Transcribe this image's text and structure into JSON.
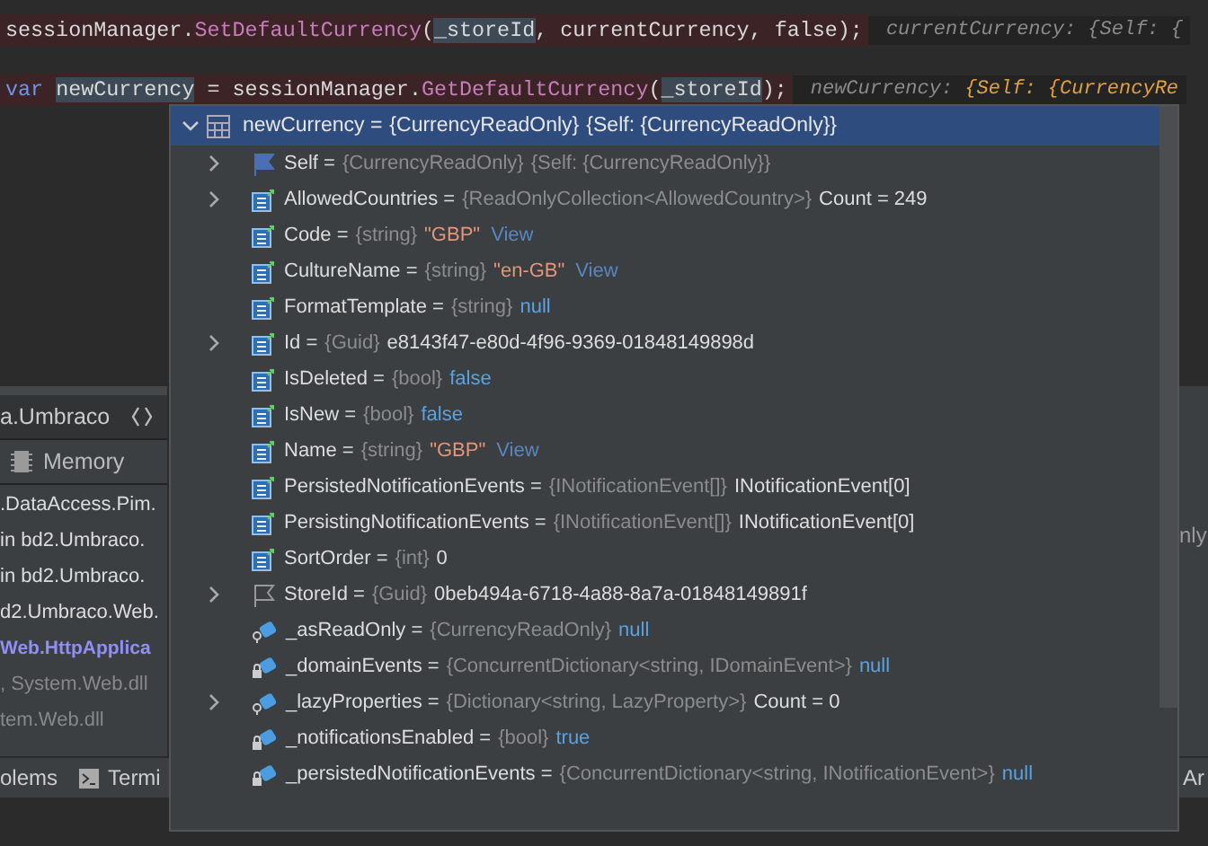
{
  "editor": {
    "lines": [
      {
        "tokens": [
          {
            "text": "sessionManager.",
            "kind": "plain"
          },
          {
            "text": "SetDefaultCurrency",
            "kind": "method"
          },
          {
            "text": "(",
            "kind": "plain"
          },
          {
            "text": "_storeId",
            "kind": "ref"
          },
          {
            "text": ", currentCurrency, false);",
            "kind": "plain"
          }
        ],
        "hints": [
          {
            "text": "currentCurrency: {Self: {",
            "kind": "name"
          }
        ]
      },
      {
        "tokens": [
          {
            "text": "var ",
            "kind": "keyword"
          },
          {
            "text": "newCurrency",
            "kind": "ref"
          },
          {
            "text": " = sessionManager.",
            "kind": "plain"
          },
          {
            "text": "GetDefaultCurrency",
            "kind": "method"
          },
          {
            "text": "(",
            "kind": "plain"
          },
          {
            "text": "_storeId",
            "kind": "ref"
          },
          {
            "text": ");",
            "kind": "plain"
          }
        ],
        "hints": [
          {
            "text": "newCurrency: ",
            "kind": "name"
          },
          {
            "text": "{Self: {CurrencyRe",
            "kind": "value"
          }
        ]
      }
    ]
  },
  "side_panel": {
    "title": "a.Umbraco",
    "tab": "Memory",
    "frames": [
      {
        "text": ".DataAccess.Pim.",
        "kind": "normal"
      },
      {
        "text": "in bd2.Umbraco.",
        "kind": "normal"
      },
      {
        "text": "in bd2.Umbraco.",
        "kind": "normal"
      },
      {
        "text": "d2.Umbraco.Web.",
        "kind": "normal"
      },
      {
        "text": "Web.HttpApplica",
        "kind": "highlight"
      },
      {
        "text": ", System.Web.dll",
        "kind": "library"
      },
      {
        "text": "tem.Web.dll",
        "kind": "library"
      }
    ]
  },
  "right_panel": {
    "texts": [
      "nly"
    ]
  },
  "bottom_bar": {
    "tabs": [
      {
        "label": "olems",
        "icon": false
      },
      {
        "label": "Termi",
        "icon": true
      }
    ],
    "right_text": "Ar"
  },
  "popup": {
    "header": {
      "name": "newCurrency =",
      "type": "{CurrencyReadOnly}",
      "value": "{Self: {CurrencyReadOnly}}",
      "expanded": true
    },
    "rows": [
      {
        "expandable": true,
        "kind": "flag",
        "name": "Self =",
        "type": "{CurrencyReadOnly}",
        "value": {
          "text": "{Self: {CurrencyReadOnly}}",
          "kind": "type"
        }
      },
      {
        "expandable": true,
        "kind": "property",
        "name": "AllowedCountries =",
        "type": "{ReadOnlyCollection<AllowedCountry>}",
        "value": {
          "text": "Count = 249",
          "kind": "plain"
        }
      },
      {
        "expandable": false,
        "kind": "property",
        "name": "Code =",
        "type": "{string}",
        "value": {
          "text": "\"GBP\"",
          "kind": "string"
        },
        "link": "View"
      },
      {
        "expandable": false,
        "kind": "property",
        "name": "CultureName =",
        "type": "{string}",
        "value": {
          "text": "\"en-GB\"",
          "kind": "string"
        },
        "link": "View"
      },
      {
        "expandable": false,
        "kind": "property",
        "name": "FormatTemplate =",
        "type": "{string}",
        "value": {
          "text": "null",
          "kind": "keyword"
        }
      },
      {
        "expandable": true,
        "kind": "property",
        "name": "Id =",
        "type": "{Guid}",
        "value": {
          "text": "e8143f47-e80d-4f96-9369-01848149898d",
          "kind": "plain"
        }
      },
      {
        "expandable": false,
        "kind": "property",
        "name": "IsDeleted =",
        "type": "{bool}",
        "value": {
          "text": "false",
          "kind": "keyword"
        }
      },
      {
        "expandable": false,
        "kind": "property",
        "name": "IsNew =",
        "type": "{bool}",
        "value": {
          "text": "false",
          "kind": "keyword"
        }
      },
      {
        "expandable": false,
        "kind": "property",
        "name": "Name =",
        "type": "{string}",
        "value": {
          "text": "\"GBP\"",
          "kind": "string"
        },
        "link": "View"
      },
      {
        "expandable": false,
        "kind": "property",
        "name": "PersistedNotificationEvents =",
        "type": "{INotificationEvent[]}",
        "value": {
          "text": "INotificationEvent[0]",
          "kind": "plain"
        }
      },
      {
        "expandable": false,
        "kind": "property",
        "name": "PersistingNotificationEvents =",
        "type": "{INotificationEvent[]}",
        "value": {
          "text": "INotificationEvent[0]",
          "kind": "plain"
        }
      },
      {
        "expandable": false,
        "kind": "property",
        "name": "SortOrder =",
        "type": "{int}",
        "value": {
          "text": "0",
          "kind": "plain"
        }
      },
      {
        "expandable": true,
        "kind": "flag-outline",
        "name": "StoreId =",
        "type": "{Guid}",
        "value": {
          "text": "0beb494a-6718-4a88-8a7a-01848149891f",
          "kind": "plain"
        }
      },
      {
        "expandable": false,
        "kind": "field-key",
        "name": "_asReadOnly =",
        "type": "{CurrencyReadOnly}",
        "value": {
          "text": "null",
          "kind": "keyword"
        }
      },
      {
        "expandable": false,
        "kind": "field-lock",
        "name": "_domainEvents =",
        "type": "{ConcurrentDictionary<string, IDomainEvent>}",
        "value": {
          "text": "null",
          "kind": "keyword"
        }
      },
      {
        "expandable": true,
        "kind": "field-key",
        "name": "_lazyProperties =",
        "type": "{Dictionary<string, LazyProperty>}",
        "value": {
          "text": "Count = 0",
          "kind": "plain"
        }
      },
      {
        "expandable": false,
        "kind": "field-lock",
        "name": "_notificationsEnabled =",
        "type": "{bool}",
        "value": {
          "text": "true",
          "kind": "keyword"
        }
      },
      {
        "expandable": false,
        "kind": "field-lock",
        "name": "_persistedNotificationEvents =",
        "type": "{ConcurrentDictionary<string, INotificationEvent>}",
        "value": {
          "text": "null",
          "kind": "keyword"
        }
      }
    ]
  }
}
